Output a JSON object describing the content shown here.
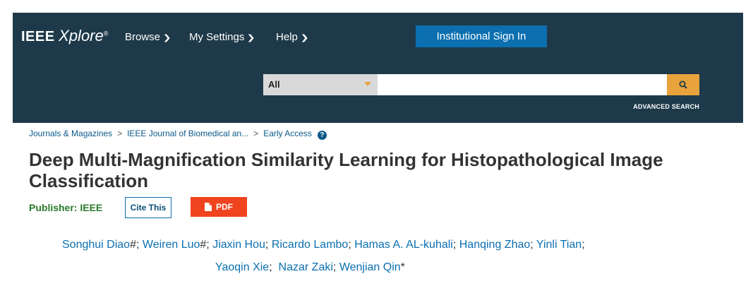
{
  "header": {
    "logo_main": "IEEE",
    "logo_italic": "Xplore",
    "logo_reg": "®",
    "nav": [
      {
        "label": "Browse"
      },
      {
        "label": "My Settings"
      },
      {
        "label": "Help"
      }
    ],
    "signin_label": "Institutional Sign In"
  },
  "search": {
    "scope_value": "All",
    "placeholder": "",
    "advanced_label": "ADVANCED SEARCH"
  },
  "breadcrumb": {
    "items": [
      "Journals & Magazines",
      "IEEE Journal of Biomedical an...",
      "Early Access"
    ],
    "separator": ">",
    "help_glyph": "?"
  },
  "article": {
    "title": "Deep Multi-Magnification Similarity Learning for Histopathological Image Classification",
    "publisher_label": "Publisher: IEEE",
    "cite_label": "Cite This",
    "pdf_label": "PDF"
  },
  "authors": {
    "line1": [
      {
        "name": "Songhui Diao",
        "mark": "#;"
      },
      {
        "name": "Weiren Luo",
        "mark": "#;"
      },
      {
        "name": "Jiaxin Hou",
        "mark": ";"
      },
      {
        "name": "Ricardo Lambo",
        "mark": ";"
      },
      {
        "name": "Hamas A. AL-kuhali",
        "mark": ";"
      },
      {
        "name": "Hanqing Zhao",
        "mark": ";"
      },
      {
        "name": "Yinli Tian",
        "mark": ";"
      }
    ],
    "line2": [
      {
        "name": "Yaoqin Xie",
        "mark": ";"
      },
      {
        "name": "Nazar Zaki",
        "mark": ";"
      },
      {
        "name": "Wenjian Qin",
        "mark": "*"
      }
    ]
  },
  "colors": {
    "header_bg": "#1e3a4a",
    "signin_bg": "#0b6fb0",
    "search_btn": "#e8a33d",
    "pdf_bg": "#f0441e",
    "publisher": "#2c7a2c",
    "link": "#0b6fb0"
  }
}
